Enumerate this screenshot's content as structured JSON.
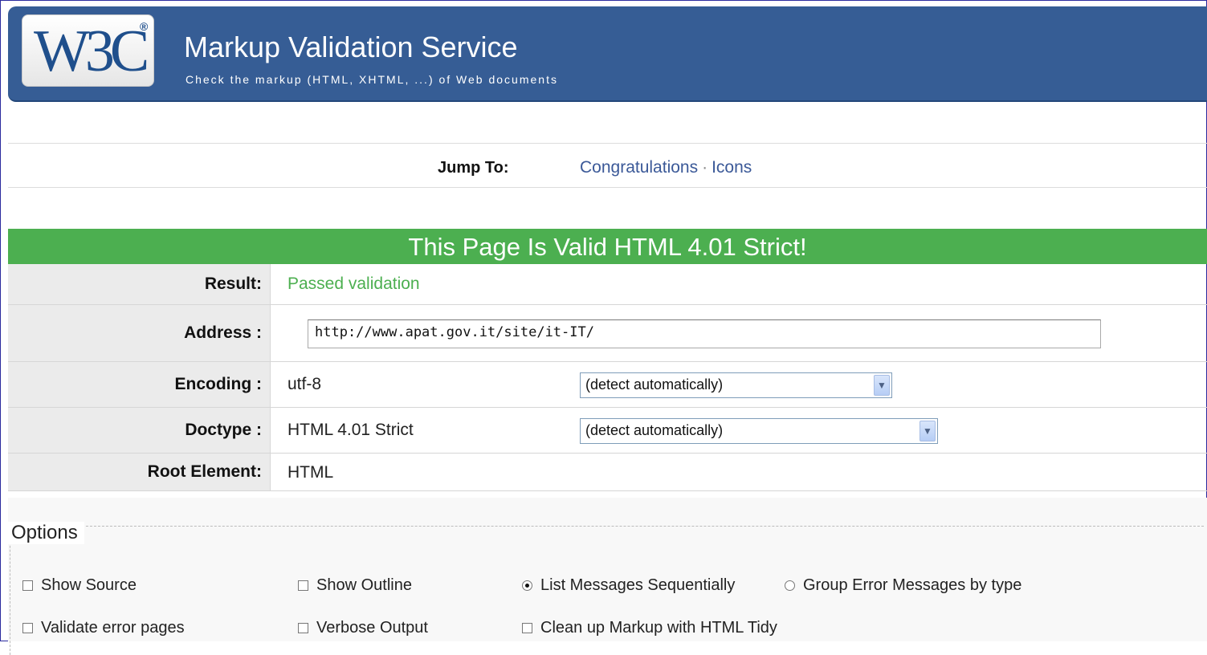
{
  "header": {
    "logo_text": "W3C",
    "logo_reg": "®",
    "title": "Markup Validation Service",
    "subtitle": "Check the markup (HTML, XHTML, ...) of Web documents"
  },
  "jump": {
    "label": "Jump To:",
    "links": [
      "Congratulations",
      "Icons"
    ],
    "separator": "·"
  },
  "banner": "This Page Is Valid HTML 4.01 Strict!",
  "results": {
    "result_label": "Result:",
    "result_value": "Passed validation",
    "address_label": "Address :",
    "address_value": "http://www.apat.gov.it/site/it-IT/",
    "encoding_label": "Encoding :",
    "encoding_value": "utf-8",
    "encoding_select": "(detect automatically)",
    "doctype_label": "Doctype :",
    "doctype_value": "HTML 4.01 Strict",
    "doctype_select": "(detect automatically)",
    "root_label": "Root Element:",
    "root_value": "HTML"
  },
  "options": {
    "title": "Options",
    "items": [
      {
        "label": "Show Source",
        "type": "checkbox",
        "checked": false
      },
      {
        "label": "Show Outline",
        "type": "checkbox",
        "checked": false
      },
      {
        "label": "List Messages Sequentially",
        "type": "radio",
        "checked": true
      },
      {
        "label": "Group Error Messages by type",
        "type": "radio",
        "checked": false
      },
      {
        "label": "Validate error pages",
        "type": "checkbox",
        "checked": false
      },
      {
        "label": "Verbose Output",
        "type": "checkbox",
        "checked": false
      },
      {
        "label": "Clean up Markup with HTML Tidy",
        "type": "checkbox",
        "checked": false
      }
    ]
  },
  "colors": {
    "header_bg": "#365d95",
    "valid_green": "#4caf50",
    "link_blue": "#3b5998"
  }
}
